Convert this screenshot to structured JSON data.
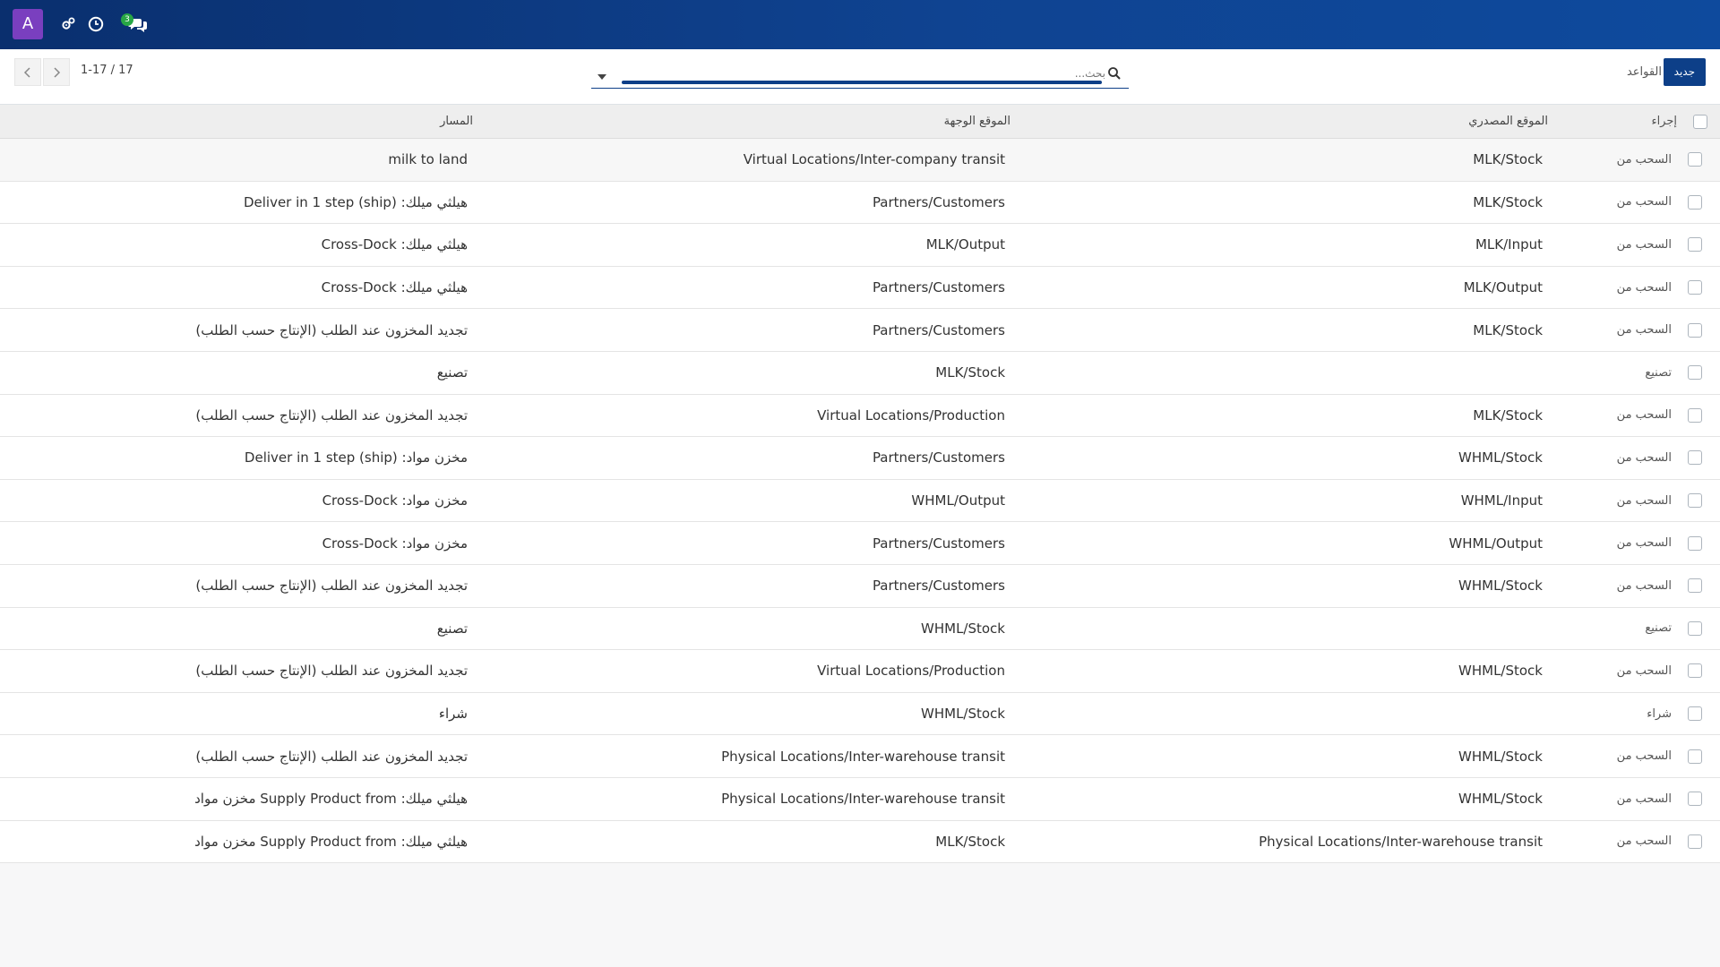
{
  "navbar": {
    "avatar_letter": "A",
    "messages_badge": "3",
    "icons": [
      "settings-tools-icon",
      "clock-icon",
      "chat-icon"
    ],
    "colors": {
      "background": "#0f4391",
      "avatar": "#7a3fbf",
      "badge": "#28a745"
    }
  },
  "control": {
    "new_button_label": "جديد",
    "title": "القواعد",
    "search_placeholder": "بحث...",
    "pager_value": "1-17 / 17"
  },
  "table": {
    "headers": {
      "action": "إجراء",
      "source": "الموقع المصدري",
      "destination": "الموقع الوجهة",
      "route": "المسار"
    },
    "rows": [
      {
        "action": "السحب من",
        "source": "MLK/Stock",
        "destination": "Virtual Locations/Inter-company transit",
        "route": "milk to land"
      },
      {
        "action": "السحب من",
        "source": "MLK/Stock",
        "destination": "Partners/Customers",
        "route": "هيلثي ميلك: Deliver in 1 step (ship)"
      },
      {
        "action": "السحب من",
        "source": "MLK/Input",
        "destination": "MLK/Output",
        "route": "هيلثي ميلك: Cross-Dock"
      },
      {
        "action": "السحب من",
        "source": "MLK/Output",
        "destination": "Partners/Customers",
        "route": "هيلثي ميلك: Cross-Dock"
      },
      {
        "action": "السحب من",
        "source": "MLK/Stock",
        "destination": "Partners/Customers",
        "route": "تجديد المخزون عند الطلب (الإنتاج حسب الطلب)"
      },
      {
        "action": "تصنيع",
        "source": "",
        "destination": "MLK/Stock",
        "route": "تصنيع"
      },
      {
        "action": "السحب من",
        "source": "MLK/Stock",
        "destination": "Virtual Locations/Production",
        "route": "تجديد المخزون عند الطلب (الإنتاج حسب الطلب)"
      },
      {
        "action": "السحب من",
        "source": "WHML/Stock",
        "destination": "Partners/Customers",
        "route": "مخزن مواد: Deliver in 1 step (ship)"
      },
      {
        "action": "السحب من",
        "source": "WHML/Input",
        "destination": "WHML/Output",
        "route": "مخزن مواد: Cross-Dock"
      },
      {
        "action": "السحب من",
        "source": "WHML/Output",
        "destination": "Partners/Customers",
        "route": "مخزن مواد: Cross-Dock"
      },
      {
        "action": "السحب من",
        "source": "WHML/Stock",
        "destination": "Partners/Customers",
        "route": "تجديد المخزون عند الطلب (الإنتاج حسب الطلب)"
      },
      {
        "action": "تصنيع",
        "source": "",
        "destination": "WHML/Stock",
        "route": "تصنيع"
      },
      {
        "action": "السحب من",
        "source": "WHML/Stock",
        "destination": "Virtual Locations/Production",
        "route": "تجديد المخزون عند الطلب (الإنتاج حسب الطلب)"
      },
      {
        "action": "شراء",
        "source": "",
        "destination": "WHML/Stock",
        "route": "شراء"
      },
      {
        "action": "السحب من",
        "source": "WHML/Stock",
        "destination": "Physical Locations/Inter-warehouse transit",
        "route": "تجديد المخزون عند الطلب (الإنتاج حسب الطلب)"
      },
      {
        "action": "السحب من",
        "source": "WHML/Stock",
        "destination": "Physical Locations/Inter-warehouse transit",
        "route": "هيلثي ميلك: Supply Product from مخزن مواد"
      },
      {
        "action": "السحب من",
        "source": "Physical Locations/Inter-warehouse transit",
        "destination": "MLK/Stock",
        "route": "هيلثي ميلك: Supply Product from مخزن مواد"
      }
    ]
  }
}
